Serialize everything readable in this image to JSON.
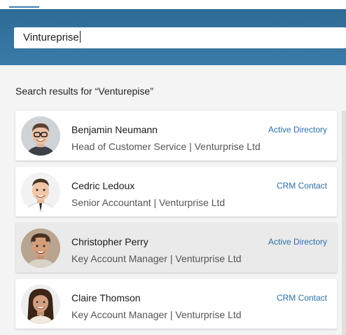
{
  "search": {
    "query": "Vintureprise"
  },
  "results_heading": "Search results for “Venturepise”",
  "results": [
    {
      "name": "Benjamin Neumann",
      "role": "Head of Customer Service | Venturprise Ltd",
      "source": "Active Directory",
      "selected": false
    },
    {
      "name": "Cedric Ledoux",
      "role": "Senior Accountant | Venturprise Ltd",
      "source": "CRM Contact",
      "selected": false
    },
    {
      "name": "Christopher Perry",
      "role": "Key Account Manager | Venturprise Ltd",
      "source": "Active Directory",
      "selected": true
    },
    {
      "name": "Claire Thomson",
      "role": "Key Account Manager | Venturprise Ltd",
      "source": "CRM Contact",
      "selected": false
    }
  ],
  "colors": {
    "header": "#2e6b96",
    "accent": "#2c6fa8",
    "selected_row": "#eaeaea"
  }
}
